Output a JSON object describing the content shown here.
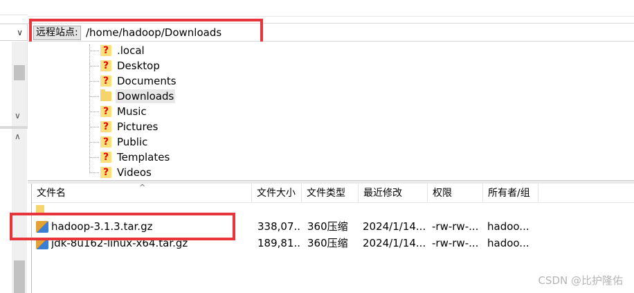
{
  "remote_site": {
    "label": "远程站点:",
    "path": "/home/hadoop/Downloads"
  },
  "tree": {
    "items": [
      {
        "label": ".local",
        "icon": "unknown-folder-icon"
      },
      {
        "label": "Desktop",
        "icon": "unknown-folder-icon"
      },
      {
        "label": "Documents",
        "icon": "unknown-folder-icon"
      },
      {
        "label": "Downloads",
        "icon": "folder-icon",
        "selected": true
      },
      {
        "label": "Music",
        "icon": "unknown-folder-icon"
      },
      {
        "label": "Pictures",
        "icon": "unknown-folder-icon"
      },
      {
        "label": "Public",
        "icon": "unknown-folder-icon"
      },
      {
        "label": "Templates",
        "icon": "unknown-folder-icon"
      },
      {
        "label": "Videos",
        "icon": "unknown-folder-icon"
      }
    ]
  },
  "file_list": {
    "columns": [
      "文件名",
      "文件大小",
      "文件类型",
      "最近修改",
      "权限",
      "所有者/组"
    ],
    "rows": [
      {
        "name": "",
        "size": "",
        "type": "",
        "modified": "",
        "perms": "",
        "owner": "",
        "icon": "parent-folder-icon"
      },
      {
        "name": "hadoop-3.1.3.tar.gz",
        "size": "338,07...",
        "type": "360压缩",
        "modified": "2024/1/14...",
        "perms": "-rw-rw-...",
        "owner": "hadoo...",
        "icon": "archive-icon"
      },
      {
        "name": "jdk-8u162-linux-x64.tar.gz",
        "size": "189,81...",
        "type": "360压缩",
        "modified": "2024/1/14...",
        "perms": "-rw-rw-...",
        "owner": "hadoo...",
        "icon": "archive-icon"
      }
    ]
  },
  "watermark": "CSDN @比护隆佑",
  "colors": {
    "highlight_box": "#e8353c",
    "selection": "#e8e8e8"
  }
}
